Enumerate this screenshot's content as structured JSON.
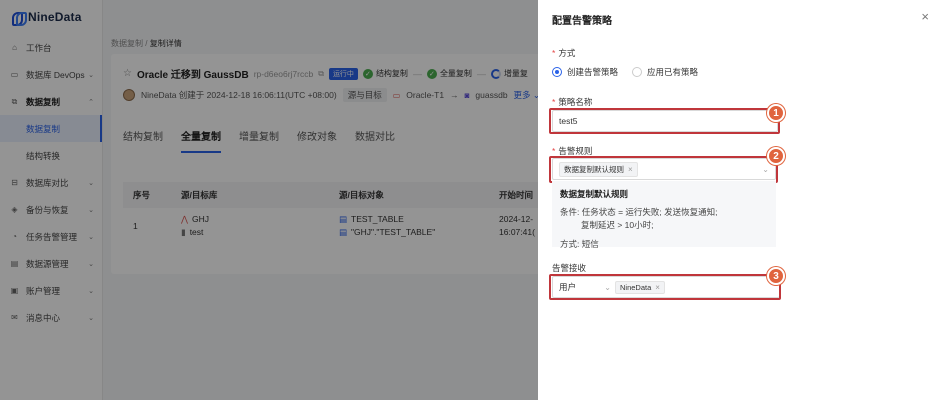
{
  "app": {
    "logo_text": "NineData"
  },
  "sidebar": {
    "items": [
      {
        "label": "工作台",
        "icon": "home-icon",
        "has_chevron": false
      },
      {
        "label": "数据库 DevOps",
        "icon": "devops-icon",
        "has_chevron": true
      },
      {
        "label": "数据复制",
        "icon": "replication-icon",
        "has_chevron": true,
        "open": true,
        "children": [
          {
            "label": "数据复制",
            "active": true
          },
          {
            "label": "结构转换"
          }
        ]
      },
      {
        "label": "数据库对比",
        "icon": "compare-icon",
        "has_chevron": true
      },
      {
        "label": "备份与恢复",
        "icon": "backup-icon",
        "has_chevron": true
      },
      {
        "label": "任务告警管理",
        "icon": "alert-icon",
        "has_chevron": true
      },
      {
        "label": "数据源管理",
        "icon": "datasource-icon",
        "has_chevron": true
      },
      {
        "label": "账户管理",
        "icon": "account-icon",
        "has_chevron": true
      },
      {
        "label": "消息中心",
        "icon": "message-icon",
        "has_chevron": true
      }
    ]
  },
  "breadcrumb": {
    "parent": "数据复制",
    "separator": "/",
    "current": "复制详情"
  },
  "task": {
    "name": "Oracle 迁移到 GaussDB",
    "id": "rp-d6eo6rj7rccb",
    "status": "运行中",
    "steps": [
      {
        "label": "结构复制",
        "state": "done"
      },
      {
        "label": "全量复制",
        "state": "done"
      },
      {
        "label": "增量复",
        "state": "running"
      }
    ],
    "creator_line": "NineData 创建于 2024-12-18 16:06:11(UTC +08:00)",
    "source_target_label": "源与目标",
    "source": "Oracle-T1",
    "target": "guassdb",
    "more": "更多"
  },
  "tabs": [
    "结构复制",
    "全量复制",
    "增量复制",
    "修改对象",
    "数据对比"
  ],
  "active_tab": 1,
  "table": {
    "headers": [
      "序号",
      "源/目标库",
      "源/目标对象",
      "开始时间"
    ],
    "rows": [
      {
        "index": "1",
        "src_db": "GHJ",
        "dst_db": "test",
        "src_obj": "TEST_TABLE",
        "dst_obj": "\"GHJ\".\"TEST_TABLE\"",
        "start_1": "2024-12-",
        "start_2": "16:07:41("
      }
    ]
  },
  "drawer": {
    "title": "配置告警策略",
    "close": "×",
    "mode_label": "方式",
    "mode_options": [
      {
        "label": "创建告警策略",
        "checked": true
      },
      {
        "label": "应用已有策略",
        "checked": false
      }
    ],
    "policy_name_label": "策略名称",
    "policy_name_value": "test5",
    "rule_label": "告警规则",
    "rule_chip": "数据复制默认规则",
    "rule_card": {
      "title": "数据复制默认规则",
      "condition_1": "条件: 任务状态 = 运行失败; 发送恢复通知;",
      "condition_2": "复制延迟 > 10小时;",
      "method": "方式: 短信"
    },
    "receive_label": "告警接收",
    "receive_type": "用户",
    "receive_chip": "NineData",
    "markers": [
      "1",
      "2",
      "3"
    ]
  },
  "colors": {
    "accent": "#2a62e8",
    "marker": "#e0643e",
    "highlight_border": "#c0363b",
    "required": "#e54545"
  }
}
